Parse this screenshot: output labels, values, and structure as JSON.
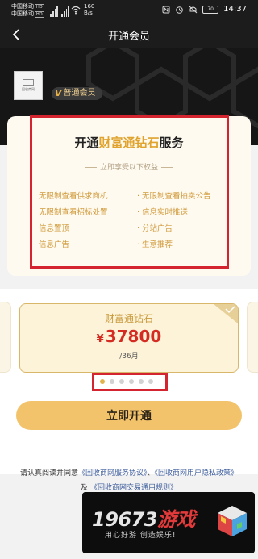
{
  "status_bar": {
    "carrier1": "中国移动",
    "carrier1_tag": "HD",
    "carrier2": "中国移动",
    "carrier2_tag": "HD",
    "speed_value": "160",
    "speed_unit": "B/s",
    "battery": "70",
    "time": "14:37"
  },
  "nav": {
    "title": "开通会员"
  },
  "profile": {
    "avatar_text": "回收商网",
    "badge_mark": "V",
    "badge_label": "普通会员"
  },
  "benefits": {
    "title_prefix": "开通",
    "title_highlight": "财富通钻石",
    "title_suffix": "服务",
    "subtitle": "立即享受以下权益",
    "items": [
      "· 无限制查看供求商机",
      "· 无限制查看拍卖公告",
      "· 无限制查看招标处置",
      "· 信息实时推送",
      "· 信息置顶",
      "· 分站广告",
      "· 信息广告",
      "· 生意推荐"
    ]
  },
  "plan": {
    "name": "财富通钻石",
    "currency": "¥",
    "price": "37800",
    "period": "/36月",
    "dots_total": 6,
    "dots_active_index": 0
  },
  "cta": {
    "label": "立即开通"
  },
  "agreement": {
    "prefix": "请认真阅读并同意",
    "link1": "《回收商网服务协议》",
    "sep": "、",
    "link2": "《回收商网用户隐私政策》",
    "and": "及",
    "link3": "《回收商网交易通用规则》"
  },
  "watermark": {
    "number": "19673",
    "brand": "游戏",
    "slogan": "用心好游  创造娱乐!"
  },
  "colors": {
    "accent_gold": "#e0a42e",
    "price_red": "#d42b22",
    "highlight_red": "#d4242f",
    "button_gold": "#f2c36a"
  }
}
